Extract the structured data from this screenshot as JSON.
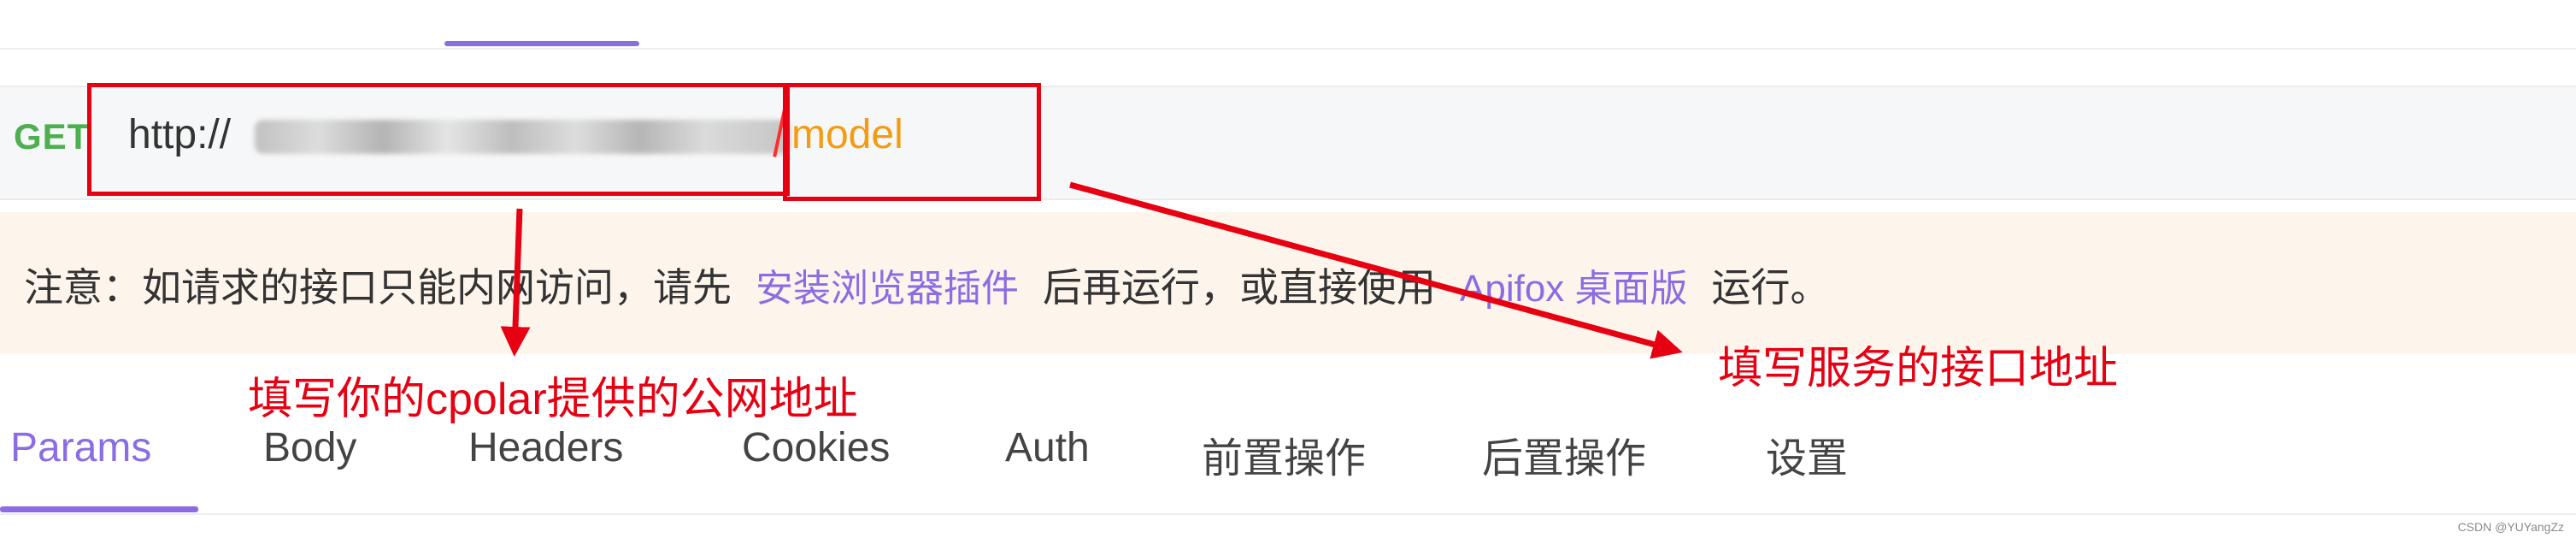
{
  "request": {
    "method": "GET",
    "url_prefix": "http://",
    "url_path": "model"
  },
  "notice": {
    "text_before": "注意：如请求的接口只能内网访问，请先",
    "link_plugin": "安装浏览器插件",
    "text_middle": "后再运行，或直接使用",
    "link_desktop": "Apifox 桌面版",
    "text_after": "运行。"
  },
  "annotations": {
    "public_address": "填写你的cpolar提供的公网地址",
    "service_path": "填写服务的接口地址"
  },
  "tabs": [
    "Params",
    "Body",
    "Headers",
    "Cookies",
    "Auth",
    "前置操作",
    "后置操作",
    "设置"
  ],
  "active_tab": "Params",
  "watermark": "CSDN @YUYangZz",
  "colors": {
    "accent": "#8b6de3",
    "method": "#4caf50",
    "url_path": "#f39c12",
    "annotation": "#e60012",
    "notice_bg": "#fdf5ec"
  }
}
